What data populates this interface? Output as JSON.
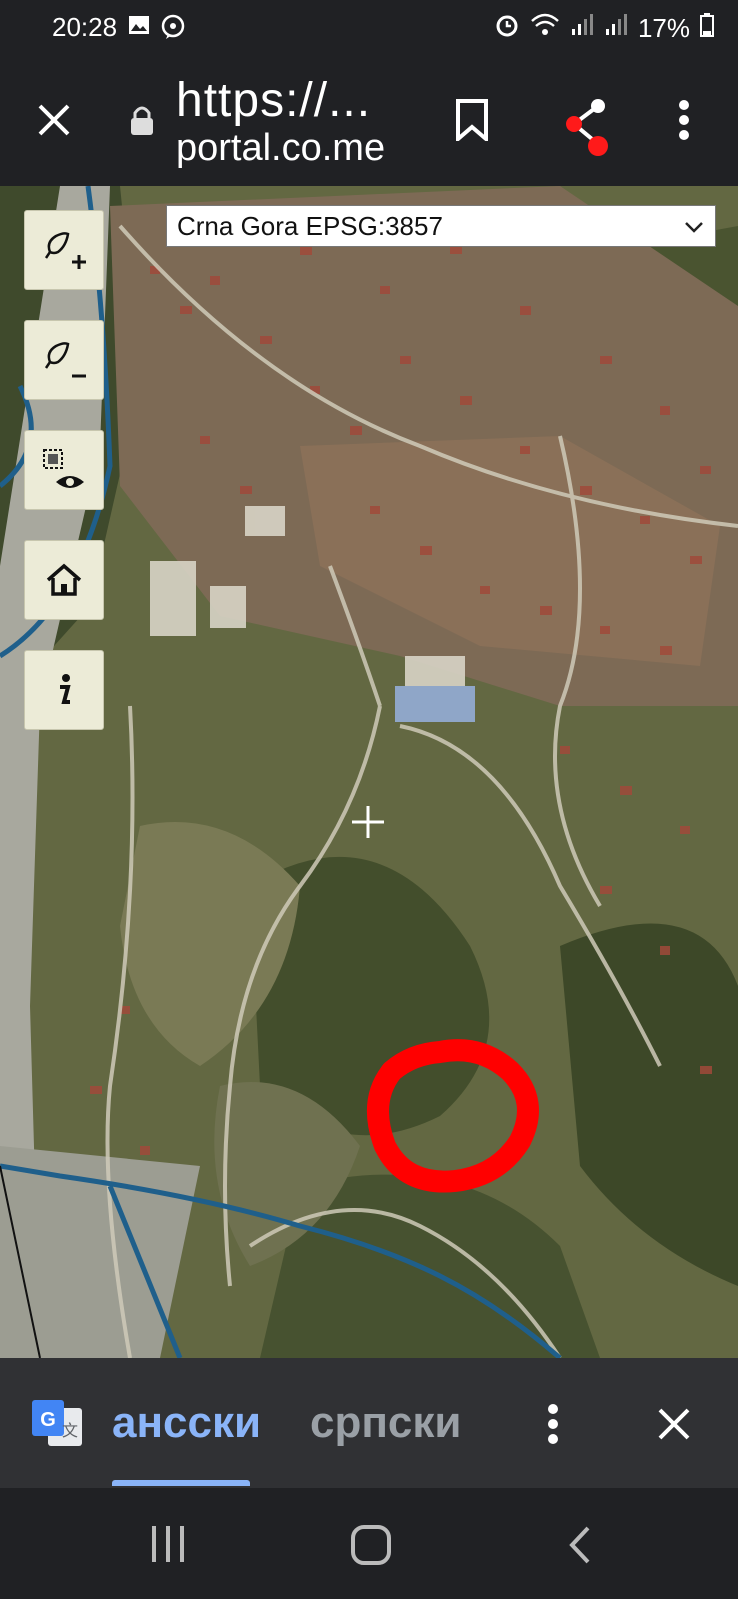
{
  "status_bar": {
    "time": "20:28",
    "battery": "17%",
    "left_icons": [
      "image-icon",
      "viber-icon"
    ],
    "right_icons": [
      "alarm-icon",
      "wifi-icon",
      "signal-icon",
      "signal-icon",
      "battery-icon"
    ]
  },
  "toolbar": {
    "url_line1": "https://...",
    "url_line2": "portal.co.me",
    "icons": [
      "close-icon",
      "lock-icon",
      "bookmark-icon",
      "share-icon",
      "more-icon"
    ],
    "share_accent": "#ff1a1a"
  },
  "map": {
    "projection_selected": "Crna Gora EPSG:3857",
    "controls": [
      "zoom-in-icon",
      "zoom-out-icon",
      "layers-visibility-icon",
      "home-icon",
      "info-icon"
    ],
    "marker_color": "#ff0000",
    "river_color": "#1f5f8b"
  },
  "translate": {
    "active_lang": "ансски",
    "other_lang": "српски",
    "accent": "#8ab4f8"
  },
  "nav": {
    "icons": [
      "recent-apps-icon",
      "home-button-icon",
      "back-icon"
    ]
  }
}
